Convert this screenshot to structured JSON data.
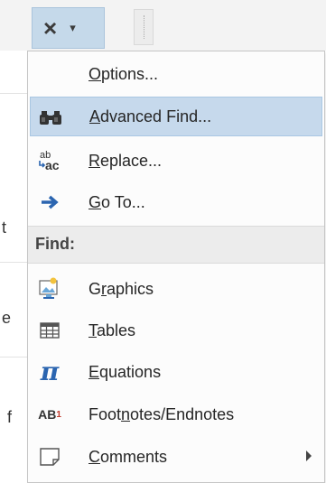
{
  "toolbar": {
    "close_glyph": "×",
    "dropdown_glyph": "▾"
  },
  "background_fragments": [
    "t",
    "e",
    "f"
  ],
  "menu": {
    "items": [
      {
        "label_pre": "",
        "label_ul": "O",
        "label_post": "ptions...",
        "icon": "none"
      },
      {
        "label_pre": "",
        "label_ul": "A",
        "label_post": "dvanced Find...",
        "icon": "binoculars-icon"
      },
      {
        "label_pre": "",
        "label_ul": "R",
        "label_post": "eplace...",
        "icon": "replace-icon",
        "icon_text_top": "ab",
        "icon_text_bottom": "ac"
      },
      {
        "label_pre": "",
        "label_ul": "G",
        "label_post": "o To...",
        "icon": "arrow-right-icon"
      }
    ],
    "section_label": "Find:",
    "find_items": [
      {
        "label_pre": "G",
        "label_ul": "r",
        "label_post": "aphics",
        "icon": "graphics-icon"
      },
      {
        "label_pre": "",
        "label_ul": "T",
        "label_post": "ables",
        "icon": "table-icon"
      },
      {
        "label_pre": "",
        "label_ul": "E",
        "label_post": "quations",
        "icon": "pi-icon",
        "icon_text": "π"
      },
      {
        "label_pre": "Foot",
        "label_ul": "n",
        "label_post": "otes/Endnotes",
        "icon": "footnote-icon",
        "icon_text": "AB",
        "icon_sup": "1"
      },
      {
        "label_pre": "",
        "label_ul": "C",
        "label_post": "omments",
        "icon": "comment-icon",
        "has_submenu": true
      }
    ]
  },
  "colors": {
    "highlight": "#c6d9ec",
    "accent_blue": "#2b65b0"
  }
}
